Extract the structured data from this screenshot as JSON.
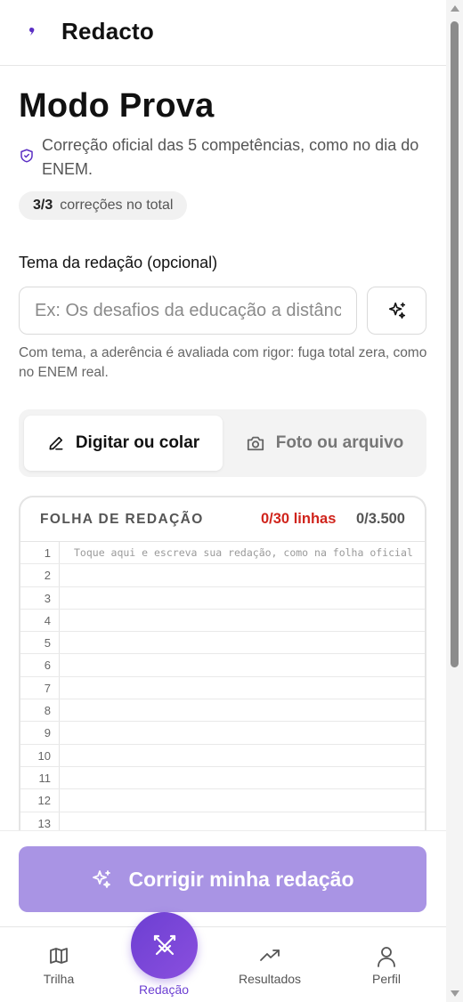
{
  "header": {
    "app_title": "Redacto"
  },
  "page": {
    "title": "Modo Prova",
    "subtitle": "Correção oficial das 5 competências, como no dia do ENEM.",
    "usage_count": "3/3",
    "usage_label": "correções no total"
  },
  "theme": {
    "label": "Tema da redação (opcional)",
    "placeholder": "Ex: Os desafios da educação a distância no Brasil",
    "hint": "Com tema, a aderência é avaliada com rigor: fuga total zera, como no ENEM real."
  },
  "tabs": [
    {
      "label": "Digitar ou colar",
      "icon": "pencil-icon",
      "active": true
    },
    {
      "label": "Foto ou arquivo",
      "icon": "camera-icon",
      "active": false
    }
  ],
  "sheet": {
    "title": "FOLHA DE REDAÇÃO",
    "lines_counter": "0/30 linhas",
    "chars_counter": "0/3.500",
    "placeholder": "Toque aqui e escreva sua redação, como na folha oficial",
    "line_numbers": [
      "1",
      "2",
      "3",
      "4",
      "5",
      "6",
      "7",
      "8",
      "9",
      "10",
      "11",
      "12",
      "13"
    ]
  },
  "submit": {
    "label": "Corrigir minha redação",
    "icon": "sparkles-icon"
  },
  "nav": {
    "items": [
      {
        "label": "Trilha",
        "icon": "map-icon"
      },
      {
        "label": "Redação",
        "icon": "swords-icon",
        "active": true
      },
      {
        "label": "Resultados",
        "icon": "trending-up-icon"
      },
      {
        "label": "Perfil",
        "icon": "user-icon"
      }
    ]
  },
  "colors": {
    "accent": "#6c3fd2",
    "submit_disabled": "#a994e4",
    "counter_alert": "#d0241c"
  }
}
